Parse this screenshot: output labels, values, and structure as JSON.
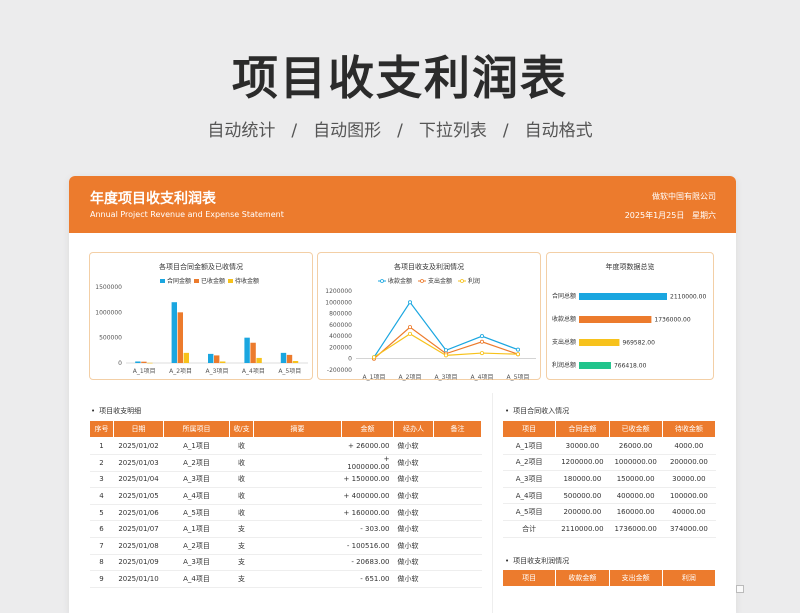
{
  "hero": {
    "title": "项目收支利润表",
    "features": [
      "自动统计",
      "/",
      "自动图形",
      "/",
      "下拉列表",
      "/",
      "自动格式"
    ]
  },
  "banner": {
    "title": "年度项目收支利润表",
    "subtitle": "Annual Project Revenue and Expense Statement",
    "company": "做软中国有限公司",
    "date": "2025年1月25日",
    "weekday": "星期六"
  },
  "colors": {
    "accent": "#ec7b2d",
    "blue": "#1aa6e0",
    "orange": "#ec7b2d",
    "yellow": "#f7c21c",
    "green": "#21c48c"
  },
  "chart_data": [
    {
      "type": "bar",
      "title": "各项目合同金额及已收情况",
      "categories": [
        "A_1项目",
        "A_2项目",
        "A_3项目",
        "A_4项目",
        "A_5项目"
      ],
      "series": [
        {
          "name": "合同金额",
          "values": [
            30000,
            1200000,
            180000,
            500000,
            200000
          ]
        },
        {
          "name": "已收金额",
          "values": [
            26000,
            1000000,
            150000,
            400000,
            160000
          ]
        },
        {
          "name": "待收金额",
          "values": [
            4000,
            200000,
            30000,
            100000,
            40000
          ]
        }
      ],
      "yticks": [
        "1500000",
        "1000000",
        "500000",
        "0"
      ],
      "ylim": [
        0,
        1500000
      ],
      "legend": "top"
    },
    {
      "type": "line",
      "title": "各项目收支及利润情况",
      "categories": [
        "A_1项目",
        "A_2项目",
        "A_3项目",
        "A_4项目",
        "A_5项目"
      ],
      "series": [
        {
          "name": "收款金额",
          "values": [
            26000,
            1000000,
            150000,
            400000,
            160000
          ]
        },
        {
          "name": "支出金额",
          "values": [
            0,
            560000,
            90000,
            300000,
            80000
          ]
        },
        {
          "name": "利润",
          "values": [
            26000,
            440000,
            60000,
            100000,
            80000
          ]
        }
      ],
      "yticks": [
        "1200000",
        "1000000",
        "800000",
        "600000",
        "400000",
        "200000",
        "0",
        "-200000"
      ],
      "ylim": [
        -200000,
        1200000
      ],
      "legend": "top"
    },
    {
      "type": "bar",
      "orientation": "horizontal",
      "title": "年度项数据总览",
      "categories": [
        "合同总额",
        "收款总额",
        "支出总额",
        "利润总额"
      ],
      "values": [
        2110000,
        1736000,
        969582,
        766418
      ],
      "labels": [
        "2110000.00",
        "1736000.00",
        "969582.00",
        "766418.00"
      ]
    }
  ],
  "detail": {
    "title": "项目收支明细",
    "headers": [
      "序号",
      "日期",
      "所属项目",
      "收/支",
      "摘要",
      "金额",
      "经办人",
      "备注"
    ],
    "rows": [
      [
        "1",
        "2025/01/02",
        "A_1项目",
        "收",
        "",
        "+ 26000.00",
        "做小软",
        ""
      ],
      [
        "2",
        "2025/01/03",
        "A_2项目",
        "收",
        "",
        "+ 1000000.00",
        "做小软",
        ""
      ],
      [
        "3",
        "2025/01/04",
        "A_3项目",
        "收",
        "",
        "+ 150000.00",
        "做小软",
        ""
      ],
      [
        "4",
        "2025/01/05",
        "A_4项目",
        "收",
        "",
        "+ 400000.00",
        "做小软",
        ""
      ],
      [
        "5",
        "2025/01/06",
        "A_5项目",
        "收",
        "",
        "+ 160000.00",
        "做小软",
        ""
      ],
      [
        "6",
        "2025/01/07",
        "A_1项目",
        "支",
        "",
        "- 303.00",
        "做小软",
        ""
      ],
      [
        "7",
        "2025/01/08",
        "A_2项目",
        "支",
        "",
        "- 100516.00",
        "做小软",
        ""
      ],
      [
        "8",
        "2025/01/09",
        "A_3项目",
        "支",
        "",
        "- 20683.00",
        "做小软",
        ""
      ],
      [
        "9",
        "2025/01/10",
        "A_4项目",
        "支",
        "",
        "- 651.00",
        "做小软",
        ""
      ]
    ]
  },
  "income": {
    "title": "项目合同收入情况",
    "headers": [
      "项目",
      "合同金额",
      "已收金额",
      "待收金额"
    ],
    "rows": [
      [
        "A_1项目",
        "30000.00",
        "26000.00",
        "4000.00"
      ],
      [
        "A_2项目",
        "1200000.00",
        "1000000.00",
        "200000.00"
      ],
      [
        "A_3项目",
        "180000.00",
        "150000.00",
        "30000.00"
      ],
      [
        "A_4项目",
        "500000.00",
        "400000.00",
        "100000.00"
      ],
      [
        "A_5项目",
        "200000.00",
        "160000.00",
        "40000.00"
      ],
      [
        "合计",
        "2110000.00",
        "1736000.00",
        "374000.00"
      ]
    ]
  },
  "profit": {
    "title": "项目收支利润情况",
    "headers": [
      "项目",
      "收款金额",
      "支出金额",
      "利润"
    ]
  }
}
